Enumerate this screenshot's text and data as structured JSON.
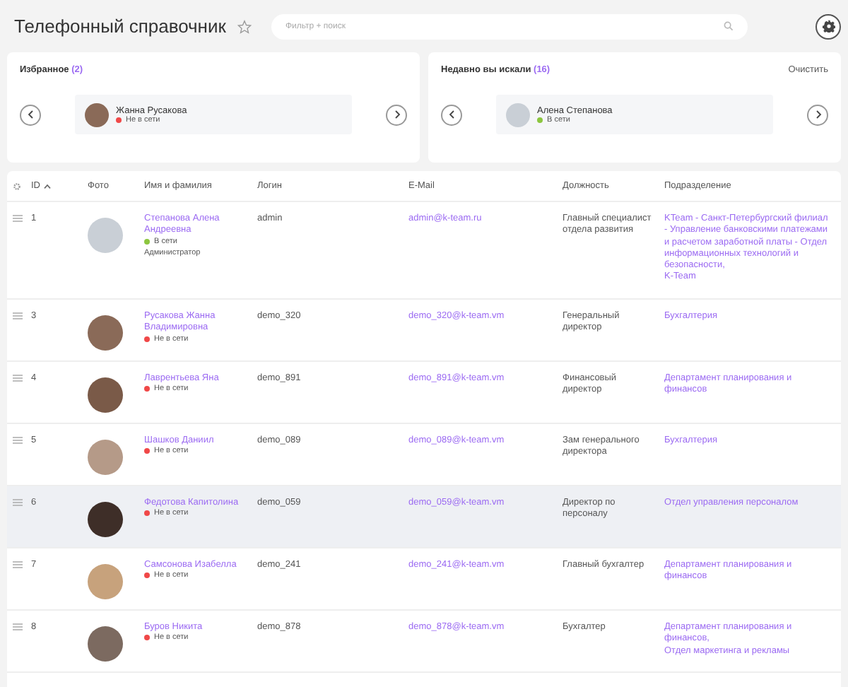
{
  "title": "Телефонный справочник",
  "search": {
    "placeholder": "Фильтр + поиск"
  },
  "favorites": {
    "title": "Избранное",
    "count": "(2)",
    "person": {
      "name": "Жанна Русакова",
      "online": false,
      "status": "Не в сети"
    }
  },
  "recent": {
    "title": "Недавно вы искали",
    "count": "(16)",
    "clear": "Очистить",
    "person": {
      "name": "Алена Степанова",
      "online": true,
      "status": "В сети"
    }
  },
  "table": {
    "columns": [
      {
        "label": "ID",
        "sorted": true
      },
      {
        "label": "Фото",
        "sorted": false
      },
      {
        "label": "Имя и фамилия",
        "sorted": false
      },
      {
        "label": "Логин",
        "sorted": false
      },
      {
        "label": "E-Mail",
        "sorted": false
      },
      {
        "label": "Должность",
        "sorted": false
      },
      {
        "label": "Подразделение",
        "sorted": false
      }
    ],
    "rows": [
      {
        "id": "1",
        "name": "Степанова Алена Андреевна",
        "online": true,
        "status": "В сети",
        "role": "Администратор",
        "login": "admin",
        "email": "admin@k-team.ru",
        "position": "Главный специалист отдела развития",
        "departments": [
          "KTeam - Санкт-Петербургский филиал - Управление банковскими платежами и расчетом заработной платы - Отдел информационных технологий и безопасности,",
          "K-Team"
        ],
        "highlighted": false
      },
      {
        "id": "3",
        "name": "Русакова Жанна Владимировна",
        "online": false,
        "status": "Не в сети",
        "login": "demo_320",
        "email": "demo_320@k-team.vm",
        "position": "Генеральный директор",
        "departments": [
          "Бухгалтерия"
        ],
        "highlighted": false
      },
      {
        "id": "4",
        "name": "Лаврентьева Яна",
        "online": false,
        "status": "Не в сети",
        "login": "demo_891",
        "email": "demo_891@k-team.vm",
        "position": "Финансовый директор",
        "departments": [
          "Департамент планирования и финансов"
        ],
        "highlighted": false
      },
      {
        "id": "5",
        "name": "Шашков Даниил",
        "online": false,
        "status": "Не в сети",
        "login": "demo_089",
        "email": "demo_089@k-team.vm",
        "position": "Зам генерального директора",
        "departments": [
          "Бухгалтерия"
        ],
        "highlighted": false
      },
      {
        "id": "6",
        "name": "Федотова Капитолина",
        "online": false,
        "status": "Не в сети",
        "login": "demo_059",
        "email": "demo_059@k-team.vm",
        "position": "Директор по персоналу",
        "departments": [
          "Отдел управления персоналом"
        ],
        "highlighted": true
      },
      {
        "id": "7",
        "name": "Самсонова Изабелла",
        "online": false,
        "status": "Не в сети",
        "login": "demo_241",
        "email": "demo_241@k-team.vm",
        "position": "Главный бухгалтер",
        "departments": [
          "Департамент планирования и финансов"
        ],
        "highlighted": false
      },
      {
        "id": "8",
        "name": "Буров Никита",
        "online": false,
        "status": "Не в сети",
        "login": "demo_878",
        "email": "demo_878@k-team.vm",
        "position": "Бухгалтер",
        "departments": [
          "Департамент планирования и финансов,",
          "Отдел маркетинга и рекламы"
        ],
        "highlighted": false
      }
    ]
  }
}
